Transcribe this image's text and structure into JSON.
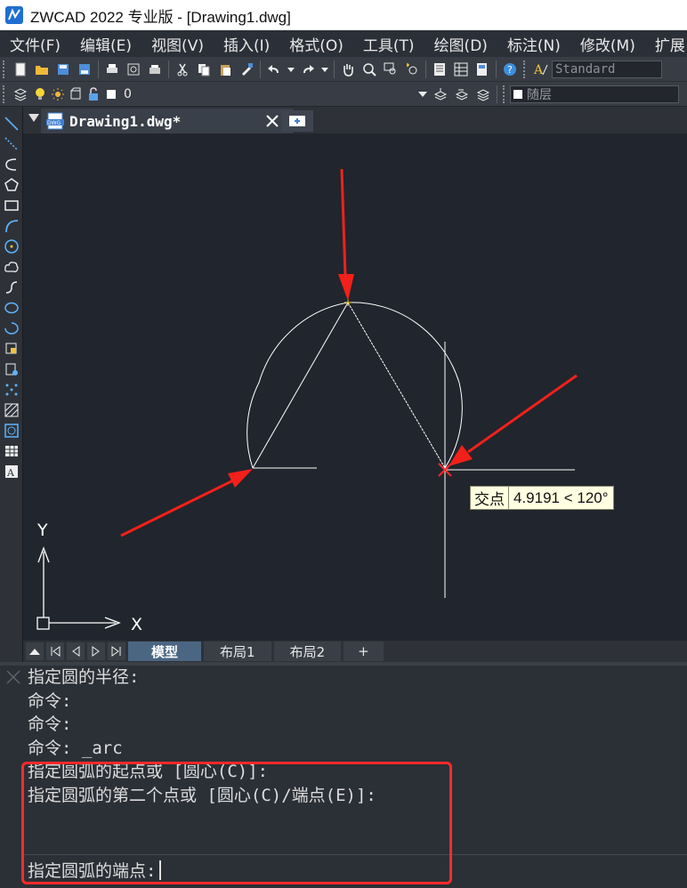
{
  "window": {
    "title": "ZWCAD 2022 专业版 - [Drawing1.dwg]"
  },
  "menubar": {
    "items": [
      "文件(F)",
      "编辑(E)",
      "视图(V)",
      "插入(I)",
      "格式(O)",
      "工具(T)",
      "绘图(D)",
      "标注(N)",
      "修改(M)",
      "扩展"
    ]
  },
  "toolbar1": {
    "text_style": "Standard"
  },
  "toolbar2": {
    "layer_name": "0",
    "linetype": "随层"
  },
  "document_tab": {
    "label": "Drawing1.dwg*"
  },
  "tooltip": {
    "label": "交点",
    "value": "4.9191 < 120°"
  },
  "ucs": {
    "x_label": "X",
    "y_label": "Y"
  },
  "layout_tabs": {
    "items": [
      "模型",
      "布局1",
      "布局2",
      "+"
    ],
    "active": "模型"
  },
  "command_window": {
    "history": [
      "指定圆的半径:",
      "命令:",
      "命令:",
      "命令: _arc",
      "指定圆弧的起点或 [圆心(C)]:",
      "指定圆弧的第二个点或 [圆心(C)/端点(E)]:"
    ],
    "prompt": "指定圆弧的端点:"
  },
  "colors": {
    "highlight": "#ff2a2a",
    "arrow": "#f2201a",
    "geometry": "#ffffff",
    "accent": "#4b6683"
  }
}
